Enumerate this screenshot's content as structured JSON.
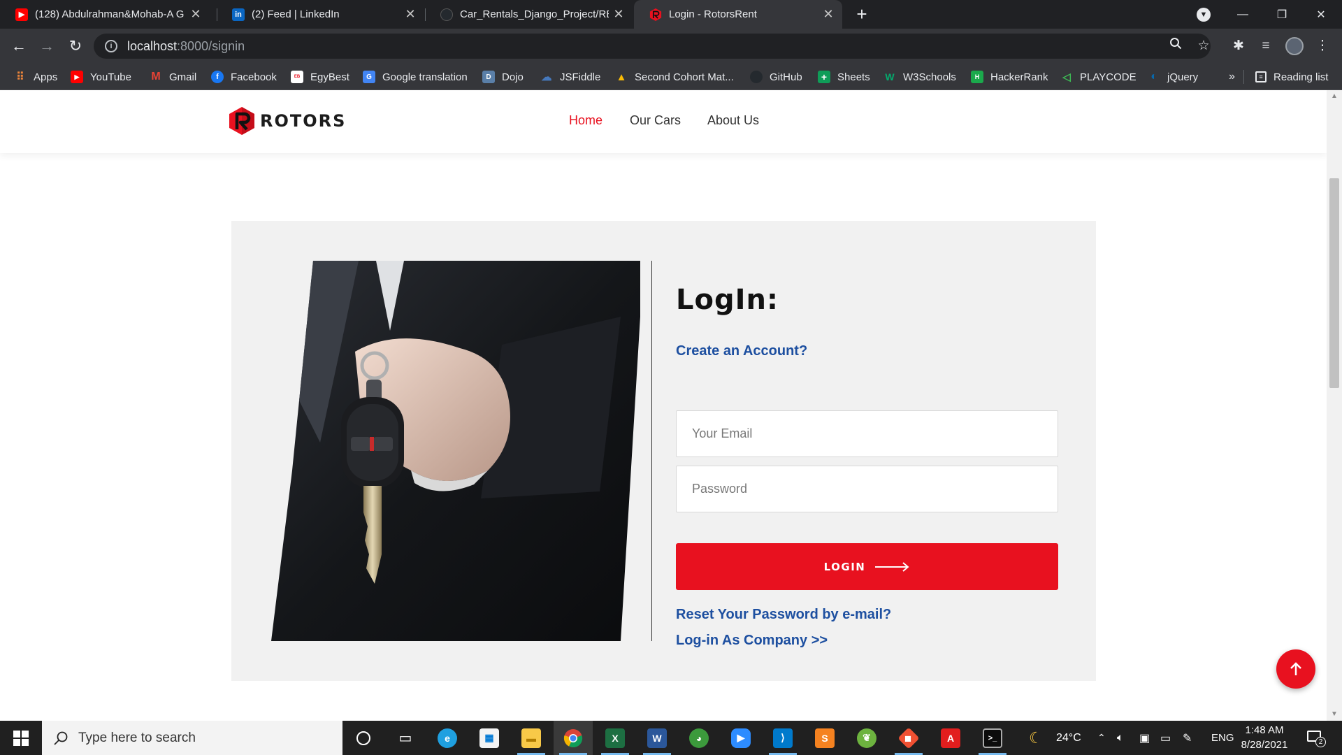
{
  "browser": {
    "tabs": [
      {
        "title": "(128) Abdulrahman&Mohab-A G",
        "favicon": "youtube-icon",
        "active": false
      },
      {
        "title": "(2) Feed | LinkedIn",
        "favicon": "linkedin-icon",
        "active": false
      },
      {
        "title": "Car_Rentals_Django_Project/REAI",
        "favicon": "github-icon",
        "active": false
      },
      {
        "title": "Login - RotorsRent",
        "favicon": "rotors-icon",
        "active": true
      }
    ],
    "new_tab_label": "+",
    "url_host": "localhost",
    "url_path": ":8000/signin",
    "bookmarks": [
      {
        "label": "Apps",
        "icon": "apps-grid-icon"
      },
      {
        "label": "YouTube",
        "icon": "youtube-icon"
      },
      {
        "label": "Gmail",
        "icon": "gmail-icon"
      },
      {
        "label": "Facebook",
        "icon": "facebook-icon"
      },
      {
        "label": "EgyBest",
        "icon": "egybest-icon"
      },
      {
        "label": "Google translation",
        "icon": "google-translate-icon"
      },
      {
        "label": "Dojo",
        "icon": "dojo-icon"
      },
      {
        "label": "JSFiddle",
        "icon": "jsfiddle-icon"
      },
      {
        "label": "Second Cohort Mat...",
        "icon": "google-drive-icon"
      },
      {
        "label": "GitHub",
        "icon": "github-icon"
      },
      {
        "label": "Sheets",
        "icon": "sheets-icon"
      },
      {
        "label": "W3Schools",
        "icon": "w3schools-icon"
      },
      {
        "label": "HackerRank",
        "icon": "hackerrank-icon"
      },
      {
        "label": "PLAYCODE",
        "icon": "playcode-icon"
      },
      {
        "label": "jQuery",
        "icon": "jquery-icon"
      }
    ],
    "more_bookmarks": "»",
    "reading_list": "Reading list"
  },
  "site": {
    "logo_text": "ROTORS",
    "nav": [
      {
        "label": "Home",
        "active": true
      },
      {
        "label": "Our Cars",
        "active": false
      },
      {
        "label": "About Us",
        "active": false
      }
    ],
    "login": {
      "heading": "LogIn:",
      "create_account": "Create an Account?",
      "email_placeholder": "Your Email",
      "password_placeholder": "Password",
      "button_label": "LOGIN",
      "reset_link": "Reset Your Password by e-mail?",
      "company_link": "Log-in As Company >>"
    }
  },
  "taskbar": {
    "search_placeholder": "Type here to search",
    "weather_temp": "24°C",
    "language": "ENG",
    "time": "1:48 AM",
    "date": "8/28/2021",
    "notification_count": "2"
  },
  "colors": {
    "accent_red": "#e8111f",
    "link_blue": "#1d4fa0",
    "chrome_dark": "#202124",
    "chrome_toolbar": "#35363a"
  }
}
